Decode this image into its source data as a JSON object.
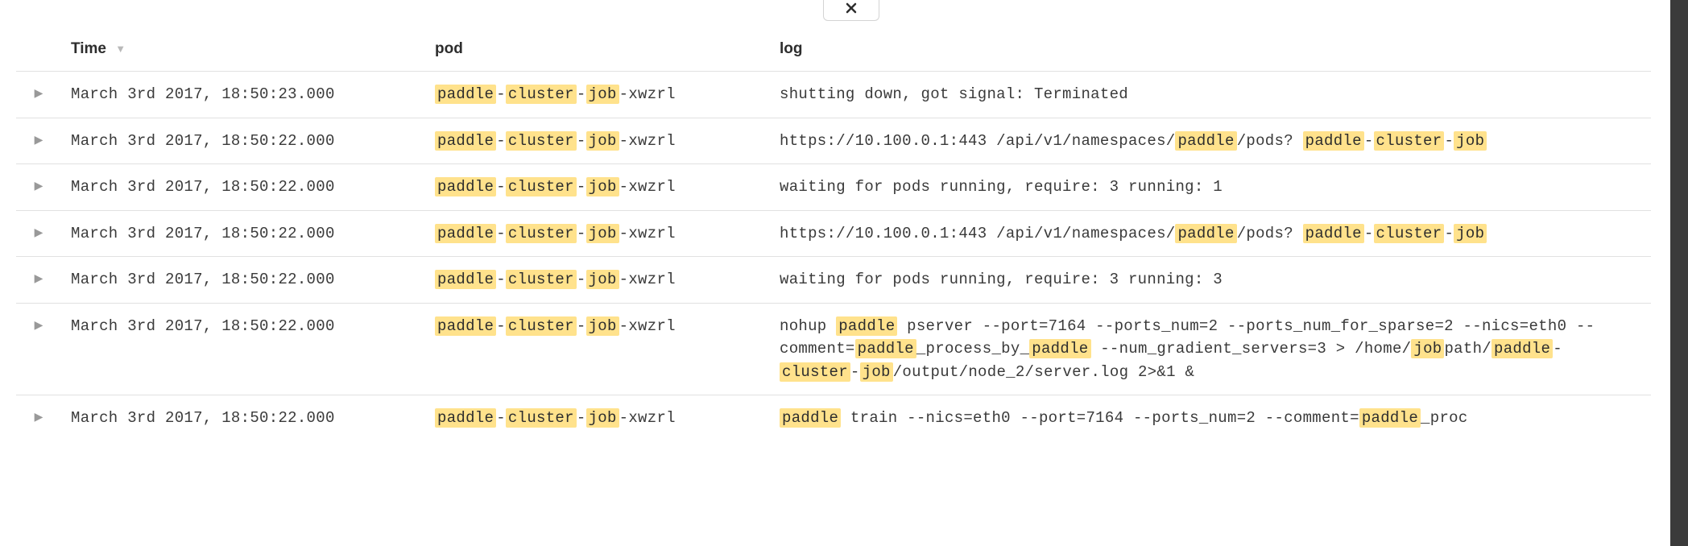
{
  "highlight_terms": [
    "paddle",
    "cluster",
    "job"
  ],
  "headers": {
    "time": "Time",
    "pod": "pod",
    "log": "log"
  },
  "rows": [
    {
      "time": "March 3rd 2017, 18:50:23.000",
      "pod": "paddle-cluster-job-xwzrl",
      "log": "shutting down, got signal: Terminated"
    },
    {
      "time": "March 3rd 2017, 18:50:22.000",
      "pod": "paddle-cluster-job-xwzrl",
      "log": "https://10.100.0.1:443 /api/v1/namespaces/paddle/pods?  paddle-cluster-job"
    },
    {
      "time": "March 3rd 2017, 18:50:22.000",
      "pod": "paddle-cluster-job-xwzrl",
      "log": "waiting for pods running, require: 3 running: 1"
    },
    {
      "time": "March 3rd 2017, 18:50:22.000",
      "pod": "paddle-cluster-job-xwzrl",
      "log": "https://10.100.0.1:443 /api/v1/namespaces/paddle/pods?  paddle-cluster-job"
    },
    {
      "time": "March 3rd 2017, 18:50:22.000",
      "pod": "paddle-cluster-job-xwzrl",
      "log": "waiting for pods running, require: 3 running: 3"
    },
    {
      "time": "March 3rd 2017, 18:50:22.000",
      "pod": "paddle-cluster-job-xwzrl",
      "log": "nohup paddle pserver --port=7164 --ports_num=2 --ports_num_for_sparse=2 --nics=eth0 --comment=paddle_process_by_paddle --num_gradient_servers=3 > /home/jobpath/paddle-cluster-job/output/node_2/server.log 2>&1 &"
    },
    {
      "time": "March 3rd 2017, 18:50:22.000",
      "pod": "paddle-cluster-job-xwzrl",
      "log": "paddle train --nics=eth0 --port=7164 --ports_num=2 --comment=paddle_proc"
    }
  ]
}
